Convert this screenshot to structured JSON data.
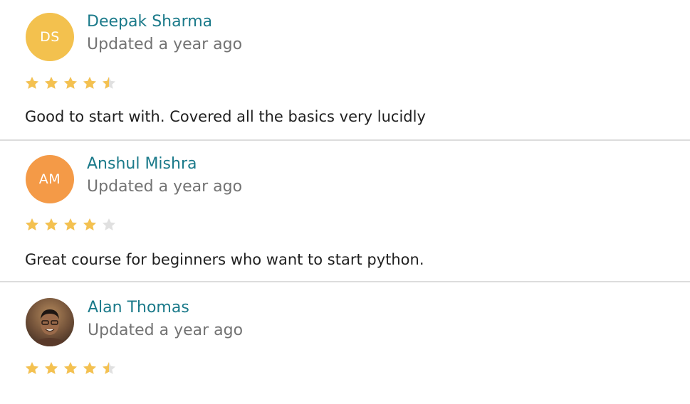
{
  "colors": {
    "name": "#1b7a8a",
    "date": "#737373",
    "star_filled": "#f4c150",
    "star_empty": "#e0e0e0",
    "divider": "#dcdcdc"
  },
  "reviews": [
    {
      "initials": "DS",
      "avatar_color": "#f3c14e",
      "name": "Deepak Sharma",
      "date": "Updated a year ago",
      "rating": 4.5,
      "text": "Good to start with. Covered all the basics very lucidly"
    },
    {
      "initials": "AM",
      "avatar_color": "#f49a47",
      "name": "Anshul Mishra",
      "date": "Updated a year ago",
      "rating": 4,
      "text": "Great course for beginners who want to start python."
    },
    {
      "initials": "",
      "avatar_color": "#6b4a35",
      "avatar_icon": "user-photo-avatar",
      "name": "Alan Thomas",
      "date": "Updated a year ago",
      "rating": 4.5,
      "text": ""
    }
  ]
}
